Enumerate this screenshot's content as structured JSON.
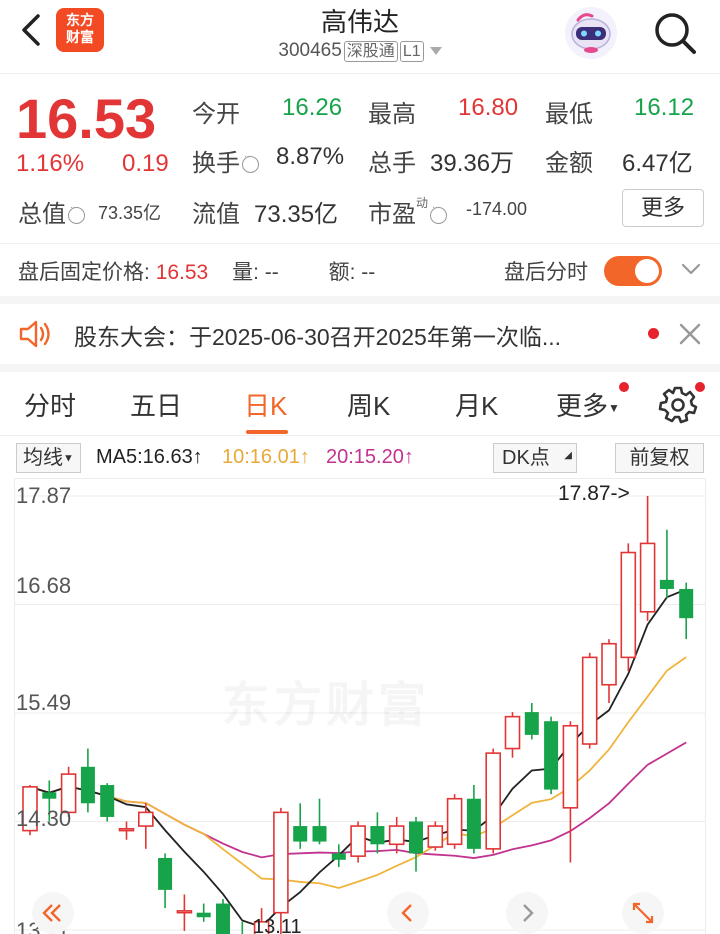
{
  "header": {
    "logo_line1": "东方",
    "logo_line2": "财富",
    "title": "高伟达",
    "code": "300465",
    "market_tag": "深股通",
    "level_tag": "L1"
  },
  "quote": {
    "price": "16.53",
    "change_pct": "1.16%",
    "change_val": "0.19",
    "open_label": "今开",
    "open": "16.26",
    "high_label": "最高",
    "high": "16.80",
    "low_label": "最低",
    "low": "16.12",
    "turnover_label": "换手",
    "turnover": "8.87%",
    "volume_label": "总手",
    "volume": "39.36万",
    "amount_label": "金额",
    "amount": "6.47亿",
    "total_cap_label": "总值",
    "total_cap": "73.35亿",
    "float_cap_label": "流值",
    "float_cap": "73.35亿",
    "pe_label": "市盈",
    "pe_sup": "动",
    "pe": "-174.00",
    "more_label": "更多"
  },
  "after_hours": {
    "price_label": "盘后固定价格:",
    "price": "16.53",
    "volume_label": "量: --",
    "amount_label": "额: --",
    "toggle_label": "盘后分时",
    "toggle_on": true
  },
  "notice": {
    "text": "股东大会：于2025-06-30召开2025年第一次临..."
  },
  "tabs": [
    {
      "label": "分时"
    },
    {
      "label": "五日"
    },
    {
      "label": "日K"
    },
    {
      "label": "周K"
    },
    {
      "label": "月K"
    },
    {
      "label": "更多"
    }
  ],
  "active_tab": "日K",
  "indicators": {
    "ma_button": "均线",
    "ma5": "MA5:16.63↑",
    "ma10": "10:16.01↑",
    "ma20": "20:15.20↑",
    "dk_button": "DK点",
    "adjust_button": "前复权"
  },
  "colors": {
    "up": "#e23535",
    "down": "#16a34a",
    "accent": "#f2662a",
    "ma5": "#222222",
    "ma10": "#f0b43c",
    "ma20": "#c2338f"
  },
  "chart_data": {
    "type": "candlestick",
    "y_tick_labels": [
      "17.87",
      "16.68",
      "15.49",
      "14.30",
      "13.11"
    ],
    "ylim": [
      13.11,
      17.87
    ],
    "max_marker": "17.87->",
    "min_marker": "13.11",
    "watermark": "东方财富",
    "candles": [
      {
        "o": 14.2,
        "h": 14.7,
        "l": 14.15,
        "c": 14.68
      },
      {
        "o": 14.62,
        "h": 14.75,
        "l": 14.3,
        "c": 14.55
      },
      {
        "o": 14.4,
        "h": 14.9,
        "l": 14.35,
        "c": 14.82
      },
      {
        "o": 14.9,
        "h": 15.1,
        "l": 14.4,
        "c": 14.5
      },
      {
        "o": 14.7,
        "h": 14.72,
        "l": 14.3,
        "c": 14.35
      },
      {
        "o": 14.2,
        "h": 14.3,
        "l": 14.1,
        "c": 14.22
      },
      {
        "o": 14.25,
        "h": 14.5,
        "l": 14.0,
        "c": 14.4
      },
      {
        "o": 13.9,
        "h": 13.95,
        "l": 13.35,
        "c": 13.55
      },
      {
        "o": 13.3,
        "h": 13.5,
        "l": 13.1,
        "c": 13.32
      },
      {
        "o": 13.3,
        "h": 13.4,
        "l": 13.2,
        "c": 13.25
      },
      {
        "o": 13.4,
        "h": 13.45,
        "l": 12.9,
        "c": 13.0
      },
      {
        "o": 13.05,
        "h": 13.2,
        "l": 12.85,
        "c": 12.95
      },
      {
        "o": 12.9,
        "h": 13.35,
        "l": 12.8,
        "c": 13.2
      },
      {
        "o": 13.3,
        "h": 14.45,
        "l": 13.0,
        "c": 14.4
      },
      {
        "o": 14.25,
        "h": 14.5,
        "l": 14.0,
        "c": 14.08
      },
      {
        "o": 14.25,
        "h": 14.55,
        "l": 14.05,
        "c": 14.08
      },
      {
        "o": 13.95,
        "h": 14.05,
        "l": 13.8,
        "c": 13.88
      },
      {
        "o": 13.92,
        "h": 14.3,
        "l": 13.85,
        "c": 14.25
      },
      {
        "o": 14.25,
        "h": 14.4,
        "l": 13.95,
        "c": 14.05
      },
      {
        "o": 14.05,
        "h": 14.35,
        "l": 13.95,
        "c": 14.25
      },
      {
        "o": 14.3,
        "h": 14.35,
        "l": 13.75,
        "c": 13.95
      },
      {
        "o": 14.02,
        "h": 14.3,
        "l": 13.98,
        "c": 14.25
      },
      {
        "o": 14.05,
        "h": 14.6,
        "l": 14.0,
        "c": 14.55
      },
      {
        "o": 14.55,
        "h": 14.7,
        "l": 13.95,
        "c": 14.0
      },
      {
        "o": 14.0,
        "h": 15.1,
        "l": 13.95,
        "c": 15.05
      },
      {
        "o": 15.1,
        "h": 15.5,
        "l": 15.0,
        "c": 15.45
      },
      {
        "o": 15.5,
        "h": 15.6,
        "l": 15.2,
        "c": 15.25
      },
      {
        "o": 15.4,
        "h": 15.45,
        "l": 14.6,
        "c": 14.65
      },
      {
        "o": 14.45,
        "h": 15.4,
        "l": 13.85,
        "c": 15.35
      },
      {
        "o": 15.15,
        "h": 16.15,
        "l": 15.1,
        "c": 16.1
      },
      {
        "o": 15.8,
        "h": 16.3,
        "l": 15.6,
        "c": 16.25
      },
      {
        "o": 16.1,
        "h": 17.35,
        "l": 15.95,
        "c": 17.25
      },
      {
        "o": 16.6,
        "h": 17.87,
        "l": 16.5,
        "c": 17.35
      },
      {
        "o": 16.95,
        "h": 17.5,
        "l": 16.75,
        "c": 16.85
      },
      {
        "o": 16.85,
        "h": 16.92,
        "l": 16.3,
        "c": 16.53
      }
    ]
  }
}
